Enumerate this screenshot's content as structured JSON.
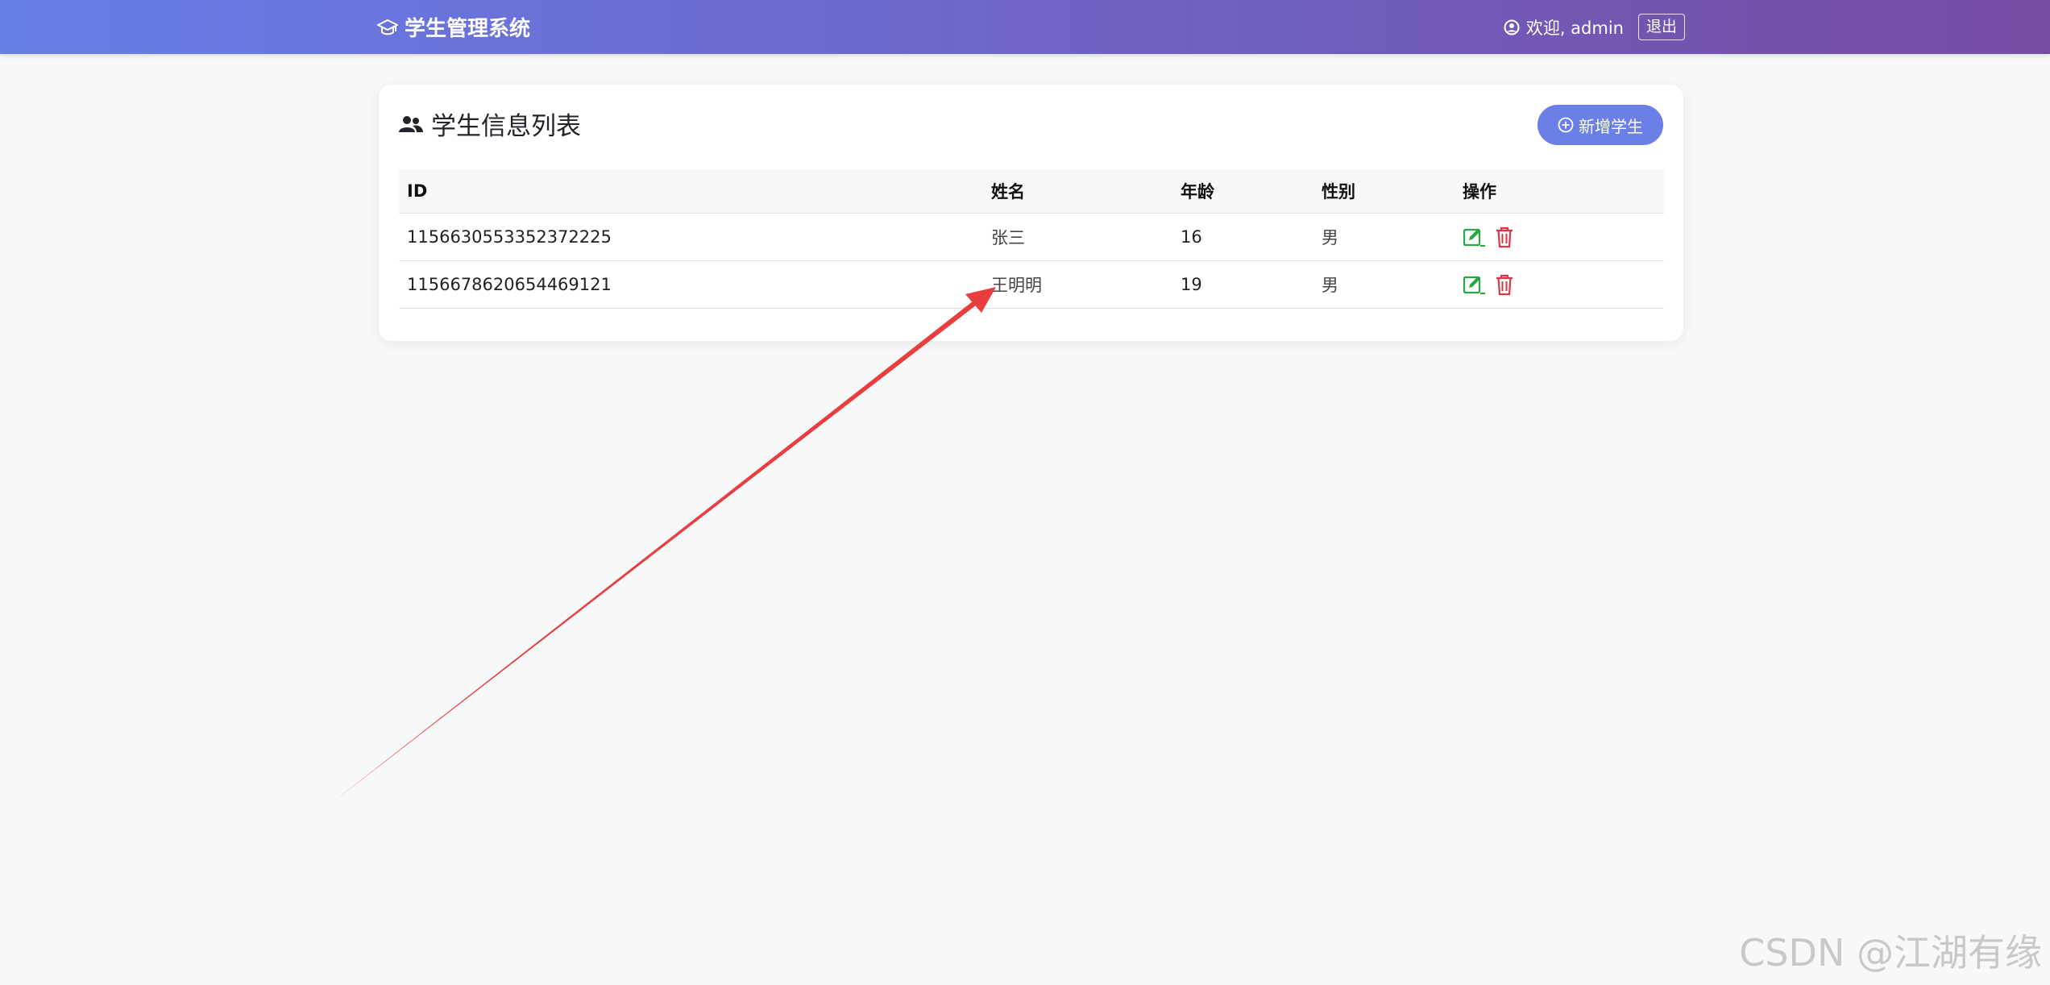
{
  "navbar": {
    "brand_icon": "graduation-cap-icon",
    "brand": "学生管理系统",
    "user_icon": "user-circle-icon",
    "welcome": "欢迎, admin",
    "logout": "退出"
  },
  "card": {
    "title_icon": "users-icon",
    "title": "学生信息列表",
    "add_icon": "plus-circle-icon",
    "add_button": "新增学生"
  },
  "table": {
    "headers": [
      "ID",
      "姓名",
      "年龄",
      "性别",
      "操作"
    ],
    "rows": [
      {
        "id": "1156630553352372225",
        "name": "张三",
        "age": "16",
        "gender": "男"
      },
      {
        "id": "1156678620654469121",
        "name": "王明明",
        "age": "19",
        "gender": "男"
      }
    ]
  },
  "colors": {
    "nav_gradient_start": "#667eea",
    "nav_gradient_end": "#764ba2",
    "primary_button": "#6c7fe6",
    "edit_icon": "#28a745",
    "delete_icon": "#dc3545",
    "annotation_arrow": "#e83e3e"
  },
  "watermark": "CSDN @江湖有缘"
}
